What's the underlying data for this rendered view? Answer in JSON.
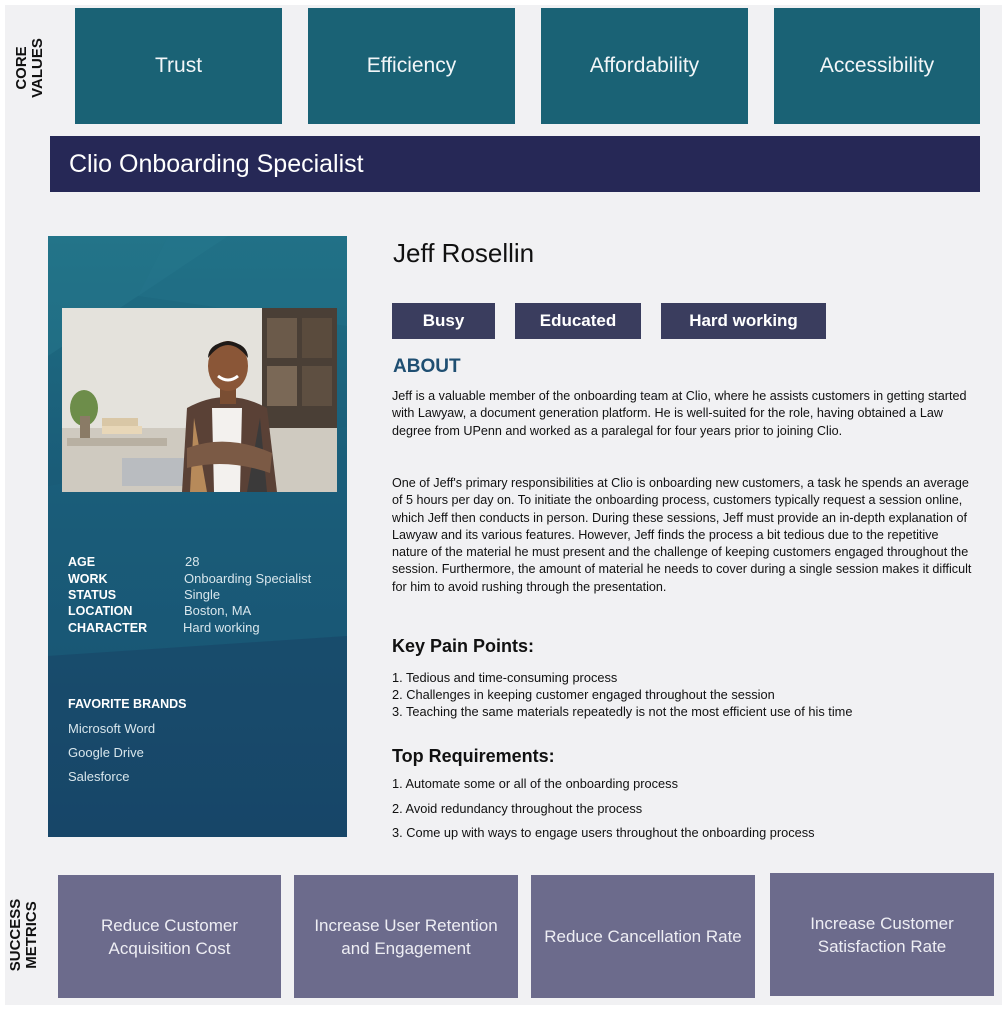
{
  "core_values": {
    "label": "CORE VALUES",
    "items": [
      "Trust",
      "Efficiency",
      "Affordability",
      "Accessibility"
    ]
  },
  "role_title": "Clio Onboarding Specialist",
  "profile": {
    "details": [
      {
        "key": "AGE",
        "value": "28"
      },
      {
        "key": "WORK",
        "value": "Onboarding Specialist"
      },
      {
        "key": "STATUS",
        "value": "Single"
      },
      {
        "key": "LOCATION",
        "value": "Boston, MA"
      },
      {
        "key": "CHARACTER",
        "value": "Hard working"
      }
    ],
    "brands_title": "FAVORITE BRANDS",
    "brands": [
      "Microsoft Word",
      "Google Drive",
      "Salesforce"
    ]
  },
  "persona": {
    "name": "Jeff Rosellin",
    "tags": [
      "Busy",
      "Educated",
      "Hard working"
    ],
    "about_heading": "ABOUT",
    "about_p1": "Jeff is a valuable member of the onboarding team at Clio, where he assists customers in getting started with Lawyaw, a document generation platform. He is well-suited for the role, having obtained a Law degree from UPenn and worked as a paralegal for four years prior to joining Clio.",
    "about_p2": "One of Jeff's primary responsibilities at Clio is onboarding new customers, a task he spends an average of 5 hours per day on. To initiate the onboarding process, customers typically request a session online, which Jeff then conducts in person. During these sessions, Jeff must provide an in-depth explanation of Lawyaw and its various features. However, Jeff finds the process a bit tedious due to the repetitive nature of the material he must present and the challenge of keeping customers engaged throughout the session. Furthermore, the amount of material he needs to cover during a single session makes it difficult for him to avoid rushing through the presentation.",
    "pain_heading": "Key Pain Points:",
    "pain_points": [
      "1. Tedious and time-consuming process",
      "2. Challenges in keeping customer engaged throughout the session",
      "3. Teaching the same materials repeatedly is not the most efficient use of his time"
    ],
    "req_heading": "Top Requirements:",
    "requirements": [
      "1. Automate some or all of the onboarding process",
      "2. Avoid redundancy throughout the process",
      "3. Come up with ways to engage users throughout the onboarding process"
    ]
  },
  "success_metrics": {
    "label": "SUCCESS METRICS",
    "items": [
      "Reduce Customer Acquisition Cost",
      "Increase User Retention and Engagement",
      "Reduce Cancellation Rate",
      "Increase Customer Satisfaction Rate"
    ]
  },
  "colors": {
    "core_value_bg": "#1a6275",
    "banner_bg": "#262856",
    "tag_bg": "#3a3d5e",
    "metric_bg": "#6c6b8c",
    "about_heading": "#1f4f72"
  }
}
